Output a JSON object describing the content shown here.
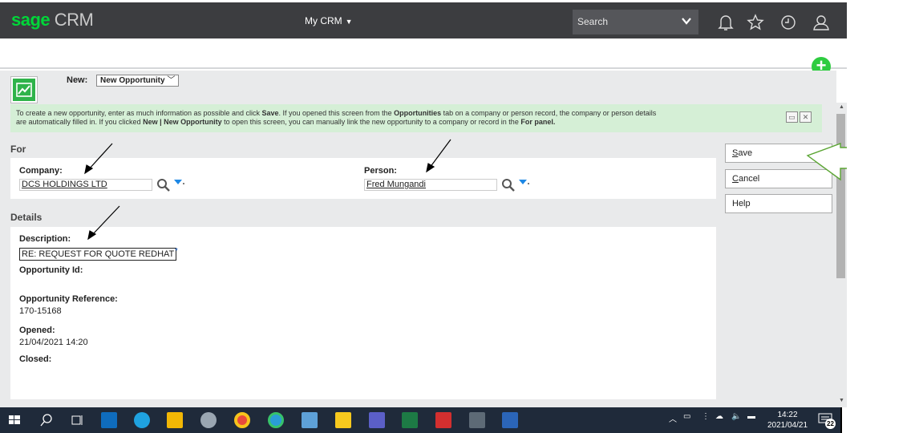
{
  "app": {
    "logo_brand": "sage",
    "logo_product": "CRM",
    "nav_label": "My CRM",
    "search_placeholder": "Search"
  },
  "toolbar": {
    "new_label": "New:",
    "new_select_value": "New Opportunity"
  },
  "info": {
    "line1_a": "To create a new opportunity, enter as much information as possible and click ",
    "line1_b": "Save",
    "line1_c": ". If you opened this screen from the ",
    "line1_d": "Opportunities",
    "line1_e": " tab on a company or person record, the company or person details",
    "line2_a": "are automatically filled in. If you clicked ",
    "line2_b": "New | New Opportunity",
    "line2_c": " to open this screen, you can manually link the new opportunity to a company or record in the ",
    "line2_d": "For panel."
  },
  "for_section": {
    "title": "For",
    "company_label": "Company:",
    "company_value": "DCS HOLDINGS LTD",
    "person_label": "Person:",
    "person_value": "Fred Mungandi"
  },
  "details_section": {
    "title": "Details",
    "description_label": "Description:",
    "description_value": "RE: REQUEST FOR QUOTE REDHAT",
    "required_mark": "*",
    "opportunity_id_label": "Opportunity Id:",
    "opportunity_ref_label": "Opportunity Reference:",
    "opportunity_ref_value": "170-15168",
    "opened_label": "Opened:",
    "opened_value": "21/04/2021 14:20",
    "closed_label": "Closed:"
  },
  "actions": {
    "save_accel": "S",
    "save_rest": "ave",
    "cancel_accel": "C",
    "cancel_rest": "ancel",
    "help_label": "Help"
  },
  "taskbar": {
    "time": "14:22",
    "date": "2021/04/21",
    "notification_count": "22"
  },
  "colors": {
    "topbar": "#3c3d40",
    "brand_green": "#00d639",
    "info_bg": "#d5efd6",
    "content_bg": "#e9eaeb",
    "annotation_green": "#5aa532",
    "taskbar": "#1f2a3a"
  }
}
